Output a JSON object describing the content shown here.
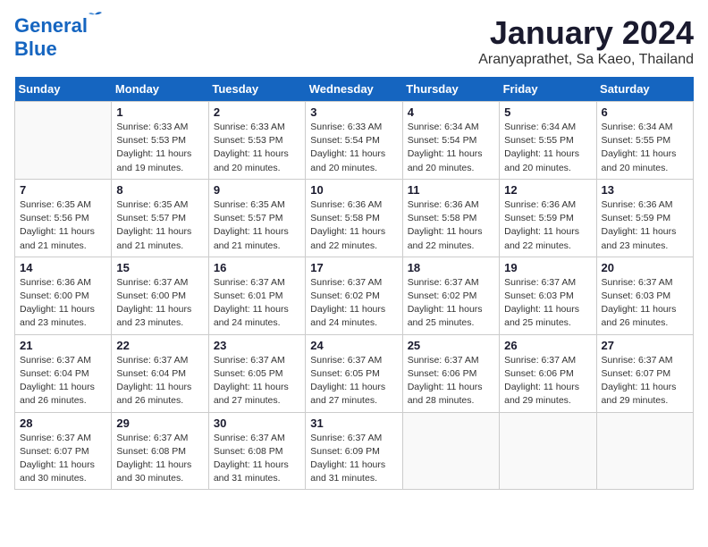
{
  "logo": {
    "line1": "General",
    "line2": "Blue"
  },
  "title": "January 2024",
  "subtitle": "Aranyaprathet, Sa Kaeo, Thailand",
  "days_header": [
    "Sunday",
    "Monday",
    "Tuesday",
    "Wednesday",
    "Thursday",
    "Friday",
    "Saturday"
  ],
  "weeks": [
    [
      {
        "num": "",
        "info": ""
      },
      {
        "num": "1",
        "info": "Sunrise: 6:33 AM\nSunset: 5:53 PM\nDaylight: 11 hours\nand 19 minutes."
      },
      {
        "num": "2",
        "info": "Sunrise: 6:33 AM\nSunset: 5:53 PM\nDaylight: 11 hours\nand 20 minutes."
      },
      {
        "num": "3",
        "info": "Sunrise: 6:33 AM\nSunset: 5:54 PM\nDaylight: 11 hours\nand 20 minutes."
      },
      {
        "num": "4",
        "info": "Sunrise: 6:34 AM\nSunset: 5:54 PM\nDaylight: 11 hours\nand 20 minutes."
      },
      {
        "num": "5",
        "info": "Sunrise: 6:34 AM\nSunset: 5:55 PM\nDaylight: 11 hours\nand 20 minutes."
      },
      {
        "num": "6",
        "info": "Sunrise: 6:34 AM\nSunset: 5:55 PM\nDaylight: 11 hours\nand 20 minutes."
      }
    ],
    [
      {
        "num": "7",
        "info": "Sunrise: 6:35 AM\nSunset: 5:56 PM\nDaylight: 11 hours\nand 21 minutes."
      },
      {
        "num": "8",
        "info": "Sunrise: 6:35 AM\nSunset: 5:57 PM\nDaylight: 11 hours\nand 21 minutes."
      },
      {
        "num": "9",
        "info": "Sunrise: 6:35 AM\nSunset: 5:57 PM\nDaylight: 11 hours\nand 21 minutes."
      },
      {
        "num": "10",
        "info": "Sunrise: 6:36 AM\nSunset: 5:58 PM\nDaylight: 11 hours\nand 22 minutes."
      },
      {
        "num": "11",
        "info": "Sunrise: 6:36 AM\nSunset: 5:58 PM\nDaylight: 11 hours\nand 22 minutes."
      },
      {
        "num": "12",
        "info": "Sunrise: 6:36 AM\nSunset: 5:59 PM\nDaylight: 11 hours\nand 22 minutes."
      },
      {
        "num": "13",
        "info": "Sunrise: 6:36 AM\nSunset: 5:59 PM\nDaylight: 11 hours\nand 23 minutes."
      }
    ],
    [
      {
        "num": "14",
        "info": "Sunrise: 6:36 AM\nSunset: 6:00 PM\nDaylight: 11 hours\nand 23 minutes."
      },
      {
        "num": "15",
        "info": "Sunrise: 6:37 AM\nSunset: 6:00 PM\nDaylight: 11 hours\nand 23 minutes."
      },
      {
        "num": "16",
        "info": "Sunrise: 6:37 AM\nSunset: 6:01 PM\nDaylight: 11 hours\nand 24 minutes."
      },
      {
        "num": "17",
        "info": "Sunrise: 6:37 AM\nSunset: 6:02 PM\nDaylight: 11 hours\nand 24 minutes."
      },
      {
        "num": "18",
        "info": "Sunrise: 6:37 AM\nSunset: 6:02 PM\nDaylight: 11 hours\nand 25 minutes."
      },
      {
        "num": "19",
        "info": "Sunrise: 6:37 AM\nSunset: 6:03 PM\nDaylight: 11 hours\nand 25 minutes."
      },
      {
        "num": "20",
        "info": "Sunrise: 6:37 AM\nSunset: 6:03 PM\nDaylight: 11 hours\nand 26 minutes."
      }
    ],
    [
      {
        "num": "21",
        "info": "Sunrise: 6:37 AM\nSunset: 6:04 PM\nDaylight: 11 hours\nand 26 minutes."
      },
      {
        "num": "22",
        "info": "Sunrise: 6:37 AM\nSunset: 6:04 PM\nDaylight: 11 hours\nand 26 minutes."
      },
      {
        "num": "23",
        "info": "Sunrise: 6:37 AM\nSunset: 6:05 PM\nDaylight: 11 hours\nand 27 minutes."
      },
      {
        "num": "24",
        "info": "Sunrise: 6:37 AM\nSunset: 6:05 PM\nDaylight: 11 hours\nand 27 minutes."
      },
      {
        "num": "25",
        "info": "Sunrise: 6:37 AM\nSunset: 6:06 PM\nDaylight: 11 hours\nand 28 minutes."
      },
      {
        "num": "26",
        "info": "Sunrise: 6:37 AM\nSunset: 6:06 PM\nDaylight: 11 hours\nand 29 minutes."
      },
      {
        "num": "27",
        "info": "Sunrise: 6:37 AM\nSunset: 6:07 PM\nDaylight: 11 hours\nand 29 minutes."
      }
    ],
    [
      {
        "num": "28",
        "info": "Sunrise: 6:37 AM\nSunset: 6:07 PM\nDaylight: 11 hours\nand 30 minutes."
      },
      {
        "num": "29",
        "info": "Sunrise: 6:37 AM\nSunset: 6:08 PM\nDaylight: 11 hours\nand 30 minutes."
      },
      {
        "num": "30",
        "info": "Sunrise: 6:37 AM\nSunset: 6:08 PM\nDaylight: 11 hours\nand 31 minutes."
      },
      {
        "num": "31",
        "info": "Sunrise: 6:37 AM\nSunset: 6:09 PM\nDaylight: 11 hours\nand 31 minutes."
      },
      {
        "num": "",
        "info": ""
      },
      {
        "num": "",
        "info": ""
      },
      {
        "num": "",
        "info": ""
      }
    ]
  ]
}
